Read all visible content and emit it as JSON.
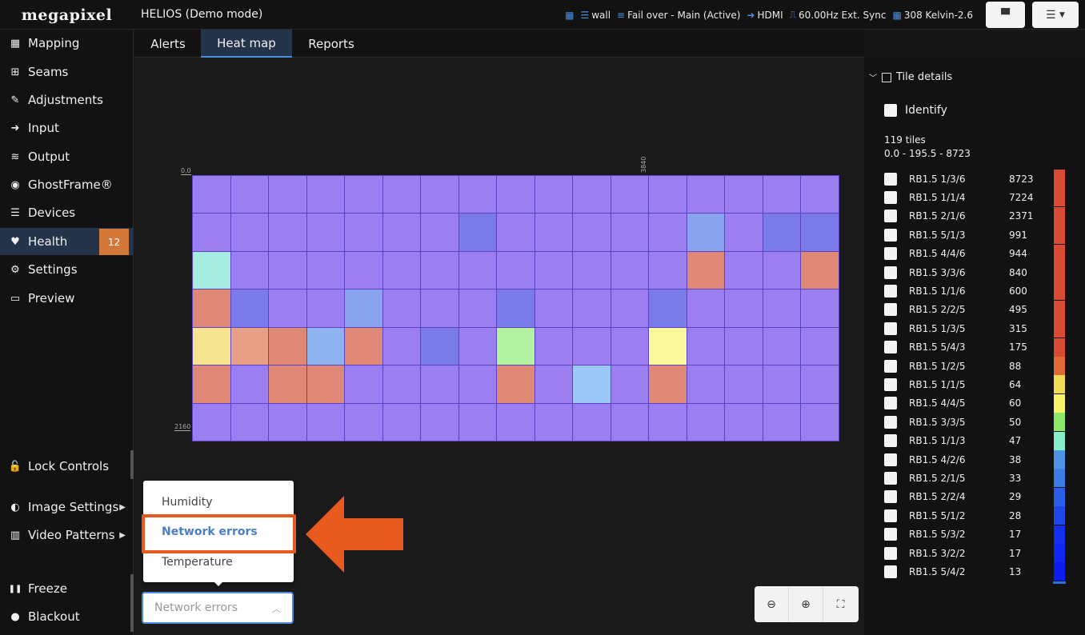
{
  "brand": "megapixel",
  "app_title": "HELIOS (Demo mode)",
  "status": {
    "calendar_icon": "calendar-icon",
    "wall": "wall",
    "failover": "Fail over - Main (Active)",
    "input": "HDMI",
    "sync": "60.00Hz Ext. Sync",
    "kelvin": "308 Kelvin-2.6"
  },
  "sidebar": {
    "items": [
      {
        "label": "Mapping",
        "icon": "grid-icon",
        "glyph": "▦"
      },
      {
        "label": "Seams",
        "icon": "plus-square-icon",
        "glyph": "⊞"
      },
      {
        "label": "Adjustments",
        "icon": "brush-icon",
        "glyph": "✎"
      },
      {
        "label": "Input",
        "icon": "sign-in-icon",
        "glyph": "➜"
      },
      {
        "label": "Output",
        "icon": "sliders-icon",
        "glyph": "≋"
      },
      {
        "label": "GhostFrame®",
        "icon": "ghostframe-icon",
        "glyph": "◉"
      },
      {
        "label": "Devices",
        "icon": "list-icon",
        "glyph": "☰"
      },
      {
        "label": "Health",
        "icon": "heart-pulse-icon",
        "glyph": "♥"
      },
      {
        "label": "Settings",
        "icon": "gears-icon",
        "glyph": "⚙"
      },
      {
        "label": "Preview",
        "icon": "monitor-icon",
        "glyph": "▭"
      }
    ],
    "health_badge": "12",
    "lock_controls": "Lock Controls",
    "image_settings": "Image Settings",
    "video_patterns": "Video Patterns",
    "freeze": "Freeze",
    "blackout": "Blackout"
  },
  "tabs": [
    "Alerts",
    "Heat map",
    "Reports"
  ],
  "heatmap": {
    "tick_origin": "0,0",
    "tick_x": "3840",
    "tick_y": "2160",
    "colors": {
      "P": "#9b7ff0",
      "B": "#7a7ae8",
      "L": "#8aa3ef",
      "S": "#8fb3ee",
      "R": "#df8878",
      "A": "#e8a086",
      "Y": "#f7e48e",
      "G": "#b2f2a0",
      "C": "#a6ece0",
      "U": "#9bc8f7",
      "V": "#f9f89a"
    },
    "rows": [
      "PPPPPPPPPPPPPPPPP",
      "PPPPPPPBPPPPPLPBB",
      "CPPPPPPPPPPPPRPPR",
      "RBPPLPPPBPPPBPPPP",
      "YARSRPBPGPPPVPPPP",
      "RPRRPPPPRPUPRPPPP",
      "PPPPPPPPPPPPPPPPP"
    ]
  },
  "dropdown": {
    "options": [
      "Humidity",
      "Network errors",
      "Temperature"
    ],
    "selected": "Network errors"
  },
  "panel": {
    "title": "Tile details",
    "identify": "Identify",
    "tile_count": "119 tiles",
    "range": "0.0 - 195.5 - 8723",
    "tiles": [
      {
        "name": "RB1.5 1/3/6",
        "value": "8723",
        "color": "#d84a33"
      },
      {
        "name": "RB1.5 1/1/4",
        "value": "7224",
        "color": "#d84a33"
      },
      {
        "name": "RB1.5 2/1/6",
        "value": "2371",
        "color": "#d84a33"
      },
      {
        "name": "RB1.5 5/1/3",
        "value": "991",
        "color": "#d84a33"
      },
      {
        "name": "RB1.5 4/4/6",
        "value": "944",
        "color": "#d84a33"
      },
      {
        "name": "RB1.5 3/3/6",
        "value": "840",
        "color": "#d84a33"
      },
      {
        "name": "RB1.5 1/1/6",
        "value": "600",
        "color": "#d84a33"
      },
      {
        "name": "RB1.5 2/2/5",
        "value": "495",
        "color": "#d84a33"
      },
      {
        "name": "RB1.5 1/3/5",
        "value": "315",
        "color": "#d84a33"
      },
      {
        "name": "RB1.5 5/4/3",
        "value": "175",
        "color": "#d84a33"
      },
      {
        "name": "RB1.5 1/2/5",
        "value": "88",
        "color": "#e26a36"
      },
      {
        "name": "RB1.5 1/1/5",
        "value": "64",
        "color": "#f1dc5a"
      },
      {
        "name": "RB1.5 4/4/5",
        "value": "60",
        "color": "#f7f36a"
      },
      {
        "name": "RB1.5 3/3/5",
        "value": "50",
        "color": "#8fe76a"
      },
      {
        "name": "RB1.5 1/1/3",
        "value": "47",
        "color": "#86eec8"
      },
      {
        "name": "RB1.5 4/2/6",
        "value": "38",
        "color": "#4f93e6"
      },
      {
        "name": "RB1.5 2/1/5",
        "value": "33",
        "color": "#3a7ce8"
      },
      {
        "name": "RB1.5 2/2/4",
        "value": "29",
        "color": "#2b5fe8"
      },
      {
        "name": "RB1.5 5/1/2",
        "value": "28",
        "color": "#1f46ea"
      },
      {
        "name": "RB1.5 5/3/2",
        "value": "17",
        "color": "#1230ee"
      },
      {
        "name": "RB1.5 3/2/2",
        "value": "17",
        "color": "#0e26f0"
      },
      {
        "name": "RB1.5 5/4/2",
        "value": "13",
        "color": "#0a1ef2"
      }
    ]
  }
}
